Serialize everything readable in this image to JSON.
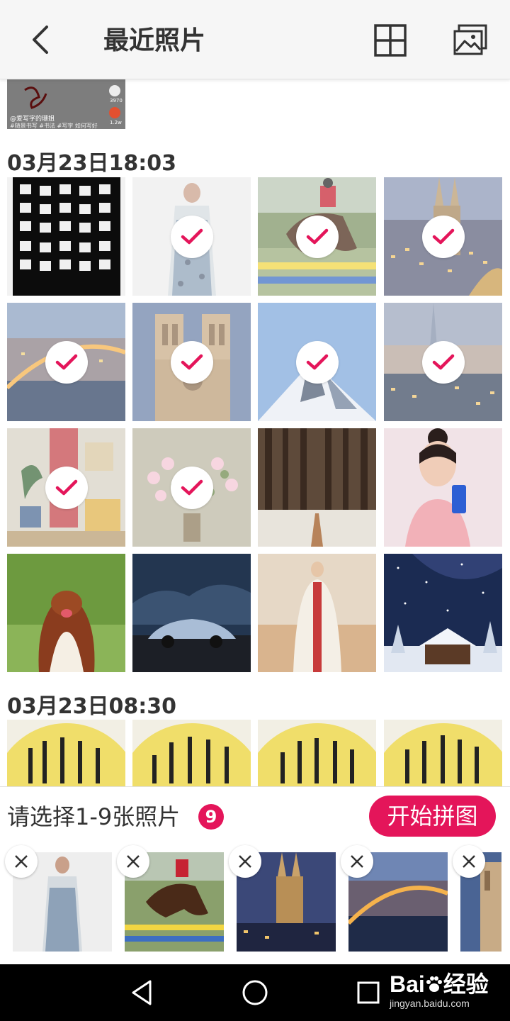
{
  "header": {
    "title": "最近照片"
  },
  "top_preview": {
    "caption": "@爱写字的珊姐",
    "tags": "#随景书写 #书法 #写字 如何写好",
    "stat1": "3970",
    "stat2": "1.2w"
  },
  "sections": [
    {
      "title": "03月23日18:03"
    },
    {
      "title": "03月23日08:30"
    }
  ],
  "photos": [
    {
      "subject": "calligraphy-scroll",
      "selected": false
    },
    {
      "subject": "woman-dress",
      "selected": true
    },
    {
      "subject": "horse-jump",
      "selected": true
    },
    {
      "subject": "cathedral-city",
      "selected": true
    },
    {
      "subject": "bridge-city",
      "selected": true
    },
    {
      "subject": "notre-dame",
      "selected": true
    },
    {
      "subject": "snow-mountain",
      "selected": true
    },
    {
      "subject": "london-skyline",
      "selected": true
    },
    {
      "subject": "room-plant",
      "selected": true
    },
    {
      "subject": "flowers-vase",
      "selected": true
    },
    {
      "subject": "forest-path",
      "selected": false
    },
    {
      "subject": "woman-phone",
      "selected": false
    },
    {
      "subject": "dog",
      "selected": false
    },
    {
      "subject": "car-storm",
      "selected": false
    },
    {
      "subject": "hanfu-woman",
      "selected": false
    },
    {
      "subject": "starry-cabin",
      "selected": false
    }
  ],
  "panel": {
    "hint": "请选择1-9张照片",
    "count": "9",
    "start_label": "开始拼图"
  },
  "watermark": {
    "main": "Bai",
    "main_cn": "经验",
    "sub": "jingyan.baidu.com"
  },
  "colors": {
    "accent": "#e4155a",
    "header_bg": "#f6f6f6"
  }
}
